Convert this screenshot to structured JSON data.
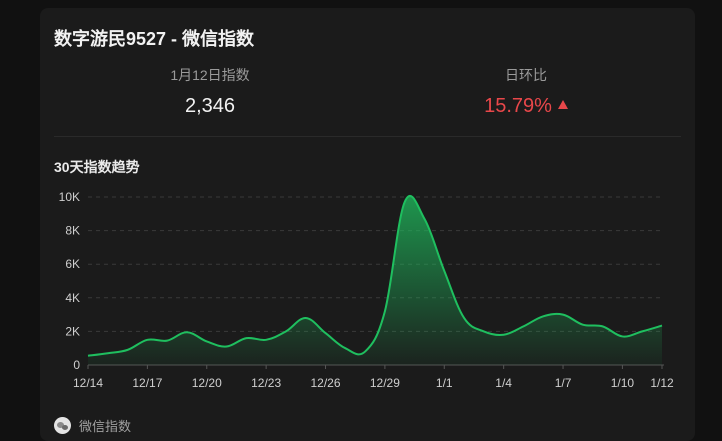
{
  "header": {
    "title": "数字游民9527 - 微信指数"
  },
  "stats": {
    "index_label": "1月12日指数",
    "index_value": "2,346",
    "change_label": "日环比",
    "change_value": "15.79%"
  },
  "section": {
    "title": "30天指数趋势"
  },
  "footer": {
    "source_label": "微信指数"
  },
  "colors": {
    "line": "#1fbf5f",
    "up": "#e8474a",
    "background": "#1b1b1b"
  },
  "chart_data": {
    "type": "area",
    "title": "30天指数趋势",
    "ylim": [
      0,
      10000
    ],
    "y_ticks": [
      0,
      2000,
      4000,
      6000,
      8000,
      10000
    ],
    "y_tick_labels": [
      "0",
      "2K",
      "4K",
      "6K",
      "8K",
      "10K"
    ],
    "x_tick_labels": [
      "12/14",
      "12/17",
      "12/20",
      "12/23",
      "12/26",
      "12/29",
      "1/1",
      "1/4",
      "1/7",
      "1/10",
      "1/12"
    ],
    "x_labels_all": [
      "12/14",
      "12/15",
      "12/16",
      "12/17",
      "12/18",
      "12/19",
      "12/20",
      "12/21",
      "12/22",
      "12/23",
      "12/24",
      "12/25",
      "12/26",
      "12/27",
      "12/28",
      "12/29",
      "12/30",
      "12/31",
      "1/1",
      "1/2",
      "1/3",
      "1/4",
      "1/5",
      "1/6",
      "1/7",
      "1/8",
      "1/9",
      "1/10",
      "1/11",
      "1/12"
    ],
    "series": [
      {
        "values": [
          550,
          700,
          900,
          1500,
          1450,
          1950,
          1400,
          1100,
          1600,
          1500,
          2000,
          2800,
          1900,
          1000,
          800,
          3200,
          9700,
          8700,
          5600,
          2800,
          2000,
          1800,
          2300,
          2900,
          3000,
          2400,
          2300,
          1700,
          2000,
          2346
        ]
      }
    ],
    "grid": true,
    "legend": "none"
  }
}
